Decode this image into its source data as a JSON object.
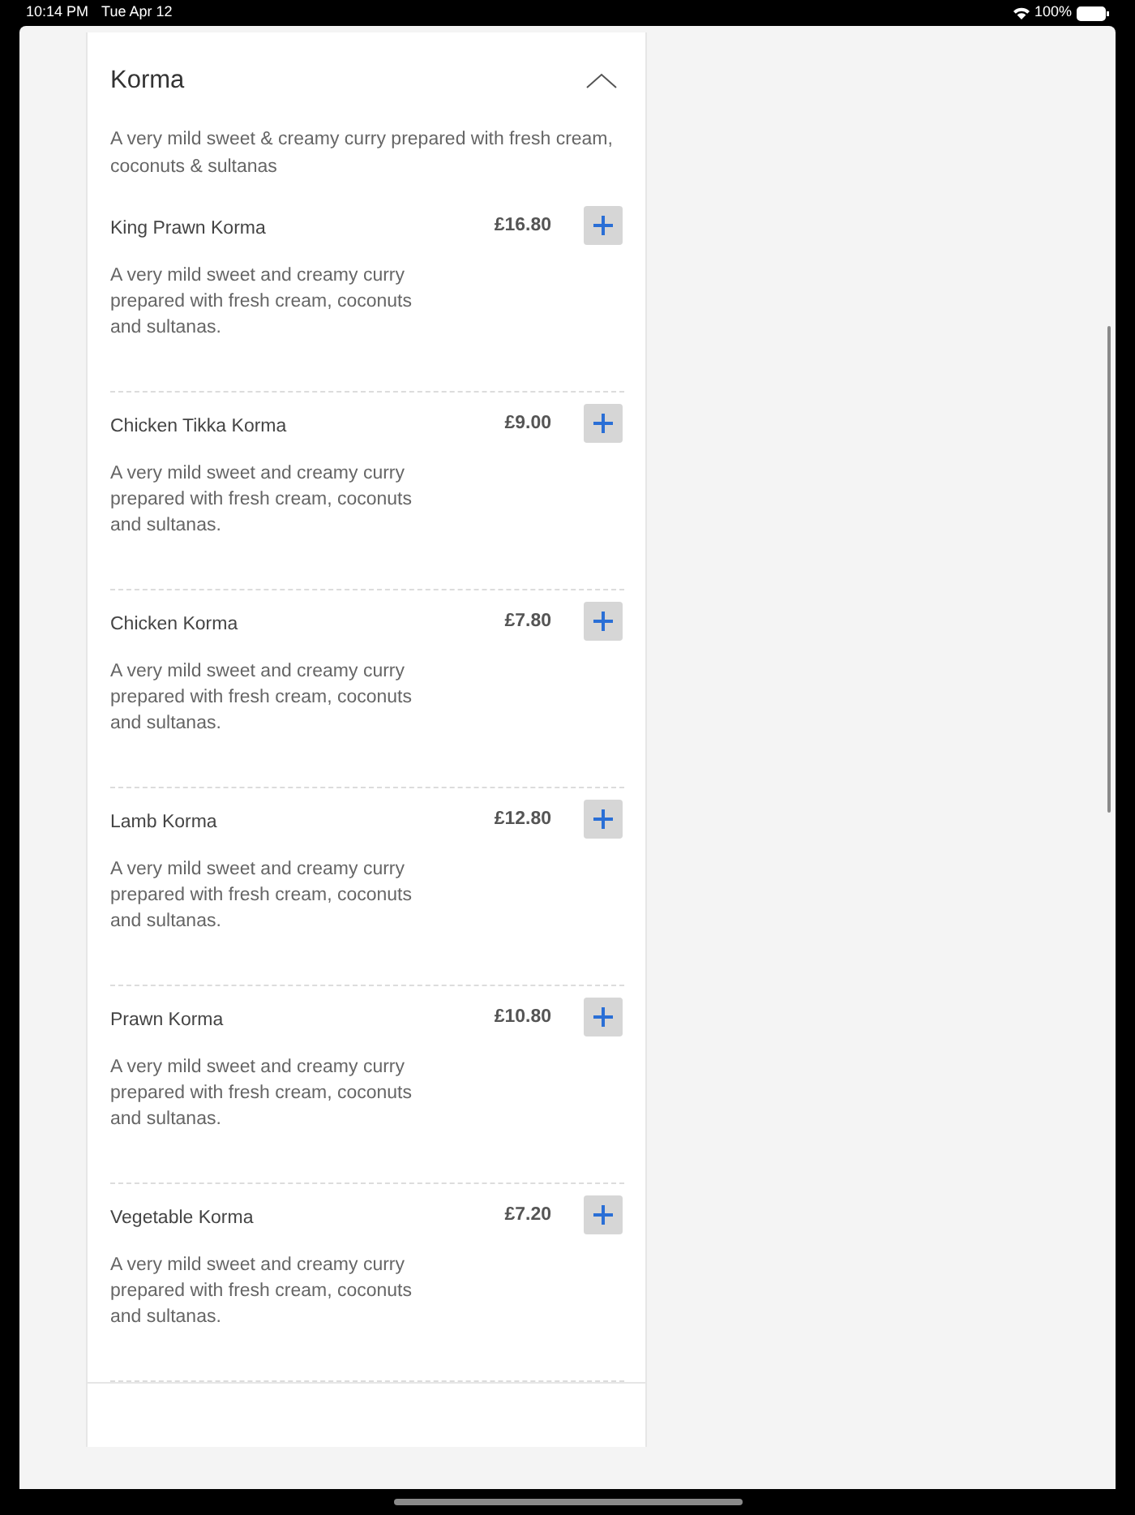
{
  "status_bar": {
    "time": "10:14 PM",
    "date": "Tue Apr 12",
    "battery": "100%"
  },
  "section": {
    "title": "Korma",
    "expanded": true,
    "description": "A very mild sweet & creamy curry prepared with fresh cream, coconuts & sultanas",
    "items": [
      {
        "name": "King Prawn Korma",
        "price": "£16.80",
        "description": "A very mild sweet and creamy curry prepared with fresh cream, coconuts and sultanas."
      },
      {
        "name": "Chicken Tikka Korma",
        "price": "£9.00",
        "description": "A very mild sweet and creamy curry prepared with fresh cream, coconuts and sultanas."
      },
      {
        "name": "Chicken Korma",
        "price": "£7.80",
        "description": "A very mild sweet and creamy curry prepared with fresh cream, coconuts and sultanas."
      },
      {
        "name": "Lamb Korma",
        "price": "£12.80",
        "description": "A very mild sweet and creamy curry prepared with fresh cream, coconuts and sultanas."
      },
      {
        "name": "Prawn Korma",
        "price": "£10.80",
        "description": "A very mild sweet and creamy curry prepared with fresh cream, coconuts and sultanas."
      },
      {
        "name": "Vegetable Korma",
        "price": "£7.20",
        "description": "A very mild sweet and creamy curry prepared with fresh cream, coconuts and sultanas."
      }
    ]
  }
}
